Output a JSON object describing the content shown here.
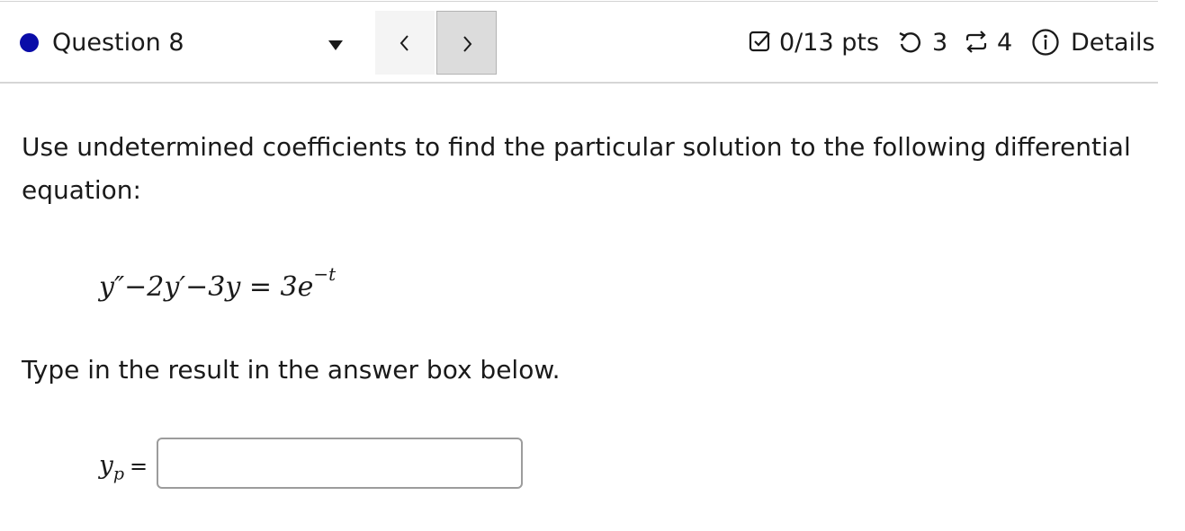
{
  "header": {
    "question_title": "Question 8",
    "points": "0/13 pts",
    "retries": "3",
    "attempts": "4",
    "details_label": "Details",
    "accent_color": "#0a0ca8",
    "icons": {
      "status": "question-status-dot-icon",
      "dropdown": "caret-down-icon",
      "prev": "chevron-left-icon",
      "next": "chevron-right-icon",
      "points": "checkbox-icon",
      "retries": "retry-icon",
      "attempts": "repeat-icon",
      "details": "info-icon"
    }
  },
  "body": {
    "prompt": "Use undetermined coefficients to find the particular solution to the following differential equation:",
    "equation_lhs": "y″−2y′−3y = 3e",
    "equation_exponent": "−t",
    "instruction": "Type in the result in the answer box below."
  },
  "answer": {
    "variable": "y",
    "subscript": "p",
    "equals": "=",
    "value": "",
    "placeholder": ""
  }
}
